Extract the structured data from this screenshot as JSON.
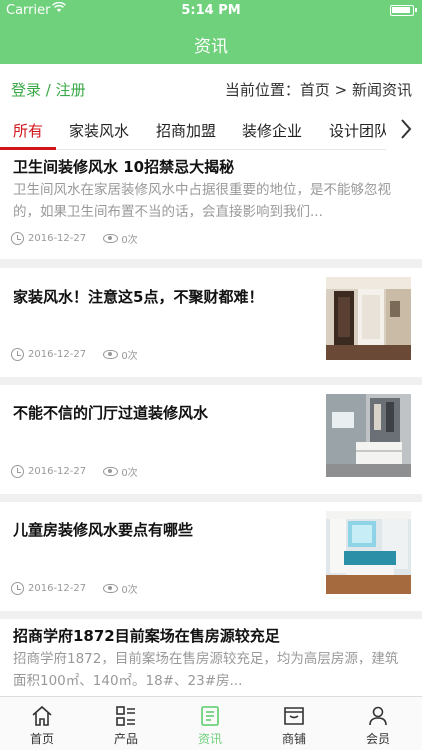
{
  "status_bar": {
    "carrier": "Carrier",
    "time": "5:14 PM"
  },
  "header": {
    "title": "资讯"
  },
  "account": {
    "login_register": "登录 / 注册"
  },
  "breadcrumb": {
    "text": "当前位置：首页 > 新闻资讯"
  },
  "tabs": [
    {
      "label": "所有",
      "active": true
    },
    {
      "label": "家装风水"
    },
    {
      "label": "招商加盟"
    },
    {
      "label": "装修企业"
    },
    {
      "label": "设计团队"
    }
  ],
  "articles": [
    {
      "title": "卫生间装修风水 10招禁忌大揭秘",
      "summary": "卫生间风水在家居装修风水中占据很重要的地位，是不能够忽视的，如果卫生间布置不当的话，会直接影响到我们...",
      "date": "2016-12-27",
      "views": "0次"
    },
    {
      "title": "家装风水！注意这5点，不聚财都难！",
      "date": "2016-12-27",
      "views": "0次",
      "thumb": "room-hallway-image"
    },
    {
      "title": "不能不信的门厅过道装修风水",
      "date": "2016-12-27",
      "views": "0次",
      "thumb": "entrance-cabinet-image"
    },
    {
      "title": "儿童房装修风水要点有哪些",
      "date": "2016-12-27",
      "views": "0次",
      "thumb": "kids-room-image"
    },
    {
      "title": "招商学府1872目前案场在售房源较充足",
      "summary": "招商学府1872，目前案场在售房源较充足，均为高层房源，建筑面积100㎡、140㎡。18#、23#房..."
    }
  ],
  "bottom_nav": [
    {
      "label": "首页",
      "icon": "home-icon"
    },
    {
      "label": "产品",
      "icon": "grid-list-icon"
    },
    {
      "label": "资讯",
      "icon": "news-icon",
      "active": true
    },
    {
      "label": "商铺",
      "icon": "shop-icon"
    },
    {
      "label": "会员",
      "icon": "user-icon"
    }
  ],
  "colors": {
    "brand_green": "#6fd17c",
    "login_green": "#39a847",
    "active_tab_red": "#d0141a"
  }
}
